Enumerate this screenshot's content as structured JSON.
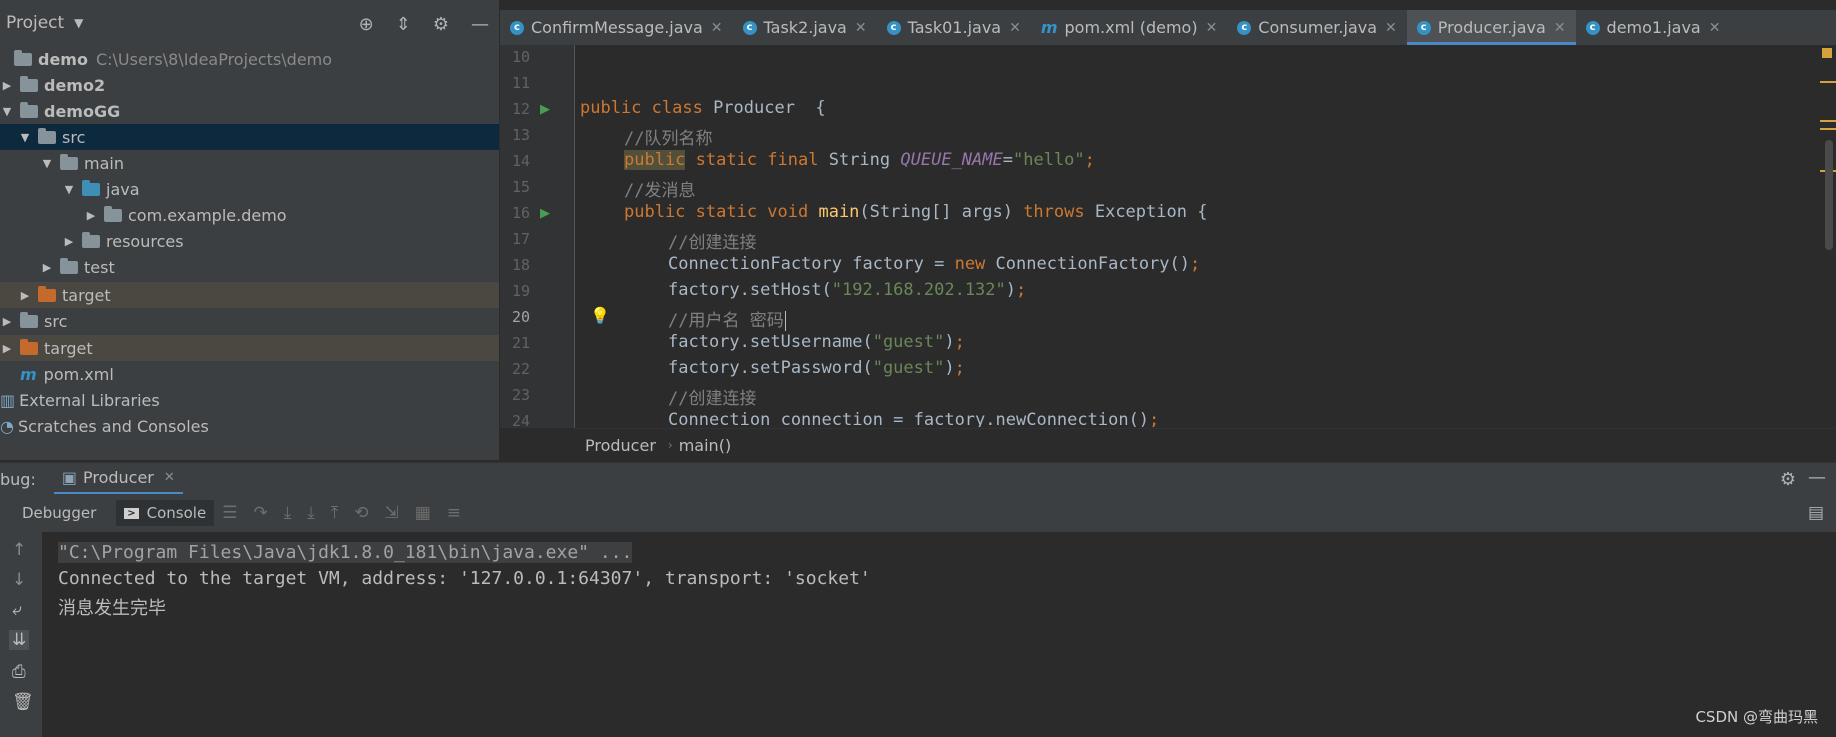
{
  "project_panel": {
    "title": "Project",
    "tree": [
      {
        "label": "demo",
        "path": "C:\\Users\\8\\IdeaProjects\\demo"
      },
      {
        "label": "demo2"
      },
      {
        "label": "demoGG"
      },
      {
        "label": "src"
      },
      {
        "label": "main"
      },
      {
        "label": "java"
      },
      {
        "label": "com.example.demo"
      },
      {
        "label": "resources"
      },
      {
        "label": "test"
      },
      {
        "label": "target"
      },
      {
        "label": "src"
      },
      {
        "label": "target"
      },
      {
        "label": "pom.xml"
      },
      {
        "label": "External Libraries"
      },
      {
        "label": "Scratches and Consoles"
      }
    ]
  },
  "tabs": [
    {
      "label": "ConfirmMessage.java",
      "icon": "class-icon"
    },
    {
      "label": "Task2.java",
      "icon": "class-icon"
    },
    {
      "label": "Task01.java",
      "icon": "class-icon"
    },
    {
      "label": "pom.xml (demo)",
      "icon": "maven-icon"
    },
    {
      "label": "Consumer.java",
      "icon": "class-icon"
    },
    {
      "label": "Producer.java",
      "icon": "class-icon",
      "active": true
    },
    {
      "label": "demo1.java",
      "icon": "class-icon"
    }
  ],
  "editor": {
    "line_numbers": [
      "10",
      "11",
      "12",
      "13",
      "14",
      "15",
      "16",
      "17",
      "18",
      "19",
      "20",
      "21",
      "22",
      "23",
      "24"
    ],
    "current_line": "20",
    "code": {
      "l12_a": "public class ",
      "l12_b": "Producer  {",
      "l13": "//队列名称",
      "l14_a": "public",
      "l14_b": " static final ",
      "l14_c": "String ",
      "l14_d": "QUEUE_NAME",
      "l14_e": "=",
      "l14_f": "\"hello\"",
      "l14_g": ";",
      "l15": "//发消息",
      "l16_a": "public static void ",
      "l16_b": "main",
      "l16_c": "(String[] args) ",
      "l16_d": "throws ",
      "l16_e": "Exception {",
      "l17": "//创建连接",
      "l18_a": "ConnectionFactory factory = ",
      "l18_b": "new ",
      "l18_c": "ConnectionFactory()",
      "l18_d": ";",
      "l19_a": "factory.setHost(",
      "l19_b": "\"192.168.202.132\"",
      "l19_c": ")",
      "l19_d": ";",
      "l20": "//用户名 密码",
      "l21_a": "factory.setUsername(",
      "l21_b": "\"guest\"",
      "l21_c": ")",
      "l21_d": ";",
      "l22_a": "factory.setPassword(",
      "l22_b": "\"guest\"",
      "l22_c": ")",
      "l22_d": ";",
      "l23": "//创建连接",
      "l24_a": "Connection connection = factory.newConnection()",
      "l24_b": ";"
    },
    "breadcrumb": [
      "Producer",
      "main()"
    ]
  },
  "debug": {
    "label": "bug:",
    "session_tab": "Producer",
    "subtabs": [
      "Debugger",
      "Console"
    ],
    "console_lines": [
      "\"C:\\Program Files\\Java\\jdk1.8.0_181\\bin\\java.exe\" ...",
      "Connected to the target VM, address: '127.0.0.1:64307', transport: 'socket'",
      "消息发生完毕"
    ]
  },
  "watermark": "CSDN @弯曲玛黑",
  "colors": {
    "accent": "#4a88c7",
    "keyword": "#cc7832",
    "string": "#6a8759",
    "comment": "#808080",
    "field": "#9876aa",
    "function": "#ffc66d"
  }
}
